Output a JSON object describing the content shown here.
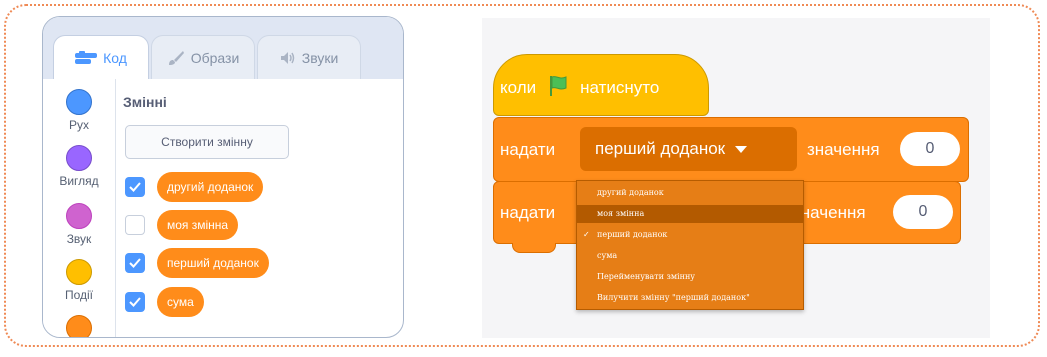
{
  "tabs": [
    {
      "label": "Код",
      "icon": "code-icon"
    },
    {
      "label": "Образи",
      "icon": "brush-icon"
    },
    {
      "label": "Звуки",
      "icon": "speaker-icon"
    }
  ],
  "categories": [
    {
      "label": "Рух",
      "color": "#4c97ff"
    },
    {
      "label": "Вигляд",
      "color": "#9966ff"
    },
    {
      "label": "Звук",
      "color": "#cf63cf"
    },
    {
      "label": "Події",
      "color": "#ffbf00"
    },
    {
      "label": "",
      "color": "#ff8c1a"
    }
  ],
  "palette": {
    "title": "Змінні",
    "make_variable": "Створити змінну",
    "variables": [
      {
        "name": "другий доданок",
        "checked": true
      },
      {
        "name": "моя змінна",
        "checked": false
      },
      {
        "name": "перший доданок",
        "checked": true
      },
      {
        "name": "сума",
        "checked": true
      }
    ]
  },
  "script": {
    "hat": {
      "when": "коли",
      "flag_icon": "green-flag-icon",
      "clicked": "натиснуто"
    },
    "set1": {
      "set": "надати",
      "variable": "перший доданок",
      "value_label": "значення",
      "value": "0"
    },
    "set2": {
      "set": "надати",
      "value_label": "значення",
      "value": "0"
    }
  },
  "dropdown": {
    "items": [
      "другий доданок",
      "моя змінна",
      "перший доданок",
      "сума",
      "Перейменувати змінну",
      "Вилучити змінну \"перший доданок\""
    ],
    "selected_index": 2,
    "hover_index": 1
  },
  "colors": {
    "accent": "#4c97ff",
    "variables": "#ff8c1a",
    "events": "#ffbf00",
    "frame": "#ef8a55"
  }
}
